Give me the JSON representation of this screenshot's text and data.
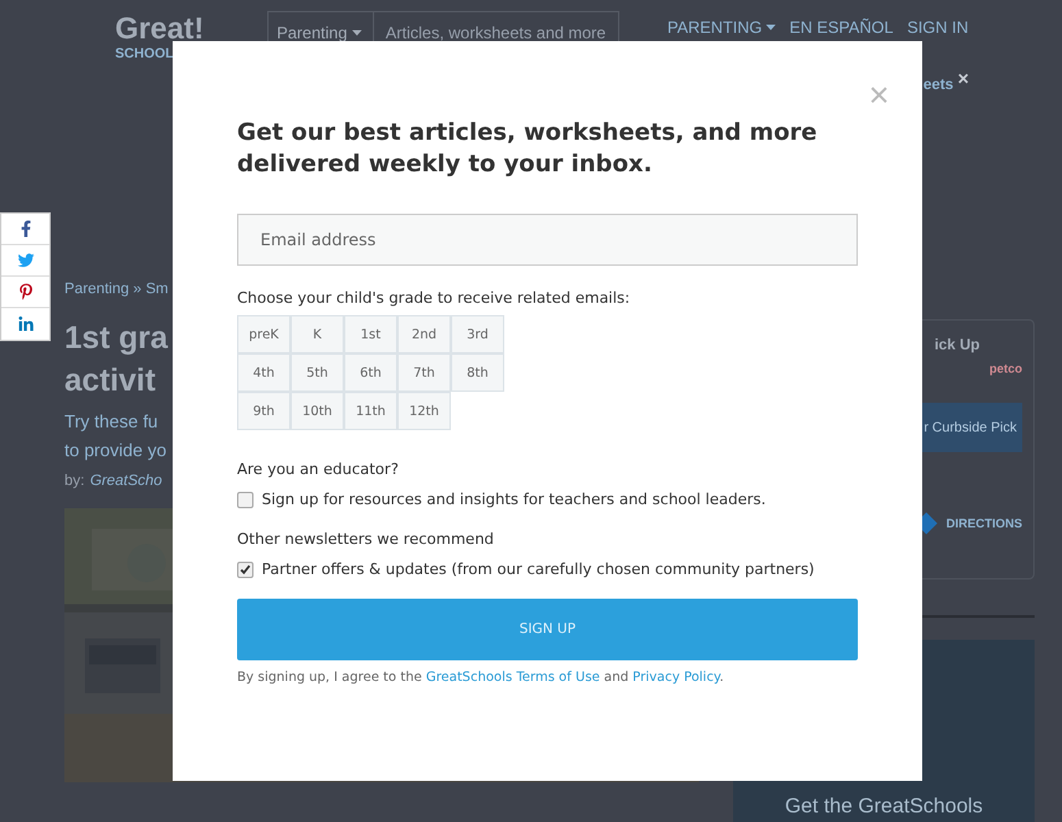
{
  "header": {
    "logo_word": "Great!",
    "logo_sub": "SCHOOL",
    "search_category": "Parenting",
    "search_placeholder": "Articles, worksheets and more",
    "nav": [
      {
        "label": "PARENTING",
        "dropdown": true
      },
      {
        "label": "EN ESPAÑOL",
        "dropdown": false
      },
      {
        "label": "SIGN IN",
        "dropdown": false
      }
    ]
  },
  "notice": {
    "link": "eets",
    "close": "×"
  },
  "article": {
    "breadcrumb": "Parenting » Sm",
    "title_lines": [
      "1st gra",
      "activit"
    ],
    "summary_lines": [
      "Try these fu",
      "to provide yo"
    ],
    "byline_prefix": "by:",
    "author": "GreatScho",
    "photo": {
      "kind": "picture"
    }
  },
  "ad": {
    "heading": "ick Up",
    "brand": "petco",
    "button": "r Curbside Pick",
    "directions": "DIRECTIONS"
  },
  "promo": {
    "title": "Get the GreatSchools"
  },
  "share": [
    {
      "kind": "facebook"
    },
    {
      "kind": "twitter"
    },
    {
      "kind": "pinterest"
    },
    {
      "kind": "linkedin"
    }
  ],
  "modal": {
    "close": "×",
    "title": "Get our best articles, worksheets, and more delivered weekly to your inbox.",
    "email_placeholder": "Email address",
    "grade_prompt": "Choose your child's grade to receive related emails:",
    "grades": [
      {
        "label": "preK",
        "selected": false
      },
      {
        "label": "K",
        "selected": false
      },
      {
        "label": "1st",
        "selected": false
      },
      {
        "label": "2nd",
        "selected": false
      },
      {
        "label": "3rd",
        "selected": false
      },
      {
        "label": "4th",
        "selected": false
      },
      {
        "label": "5th",
        "selected": false
      },
      {
        "label": "6th",
        "selected": false
      },
      {
        "label": "7th",
        "selected": false
      },
      {
        "label": "8th",
        "selected": false
      },
      {
        "label": "9th",
        "selected": false
      },
      {
        "label": "10th",
        "selected": false
      },
      {
        "label": "11th",
        "selected": false
      },
      {
        "label": "12th",
        "selected": false
      }
    ],
    "sections": [
      {
        "heading": "Are you an educator?",
        "option": "Sign up for resources and insights for teachers and school leaders.",
        "checked": false
      },
      {
        "heading": "Other newsletters we recommend",
        "option": "Partner offers & updates (from our carefully chosen community partners)",
        "checked": true
      }
    ],
    "submit": "SIGN UP",
    "legal": {
      "before": "By signing up, I agree to the ",
      "terms": "GreatSchools Terms of Use",
      "middle": " and ",
      "privacy": "Privacy Policy",
      "after": "."
    }
  }
}
